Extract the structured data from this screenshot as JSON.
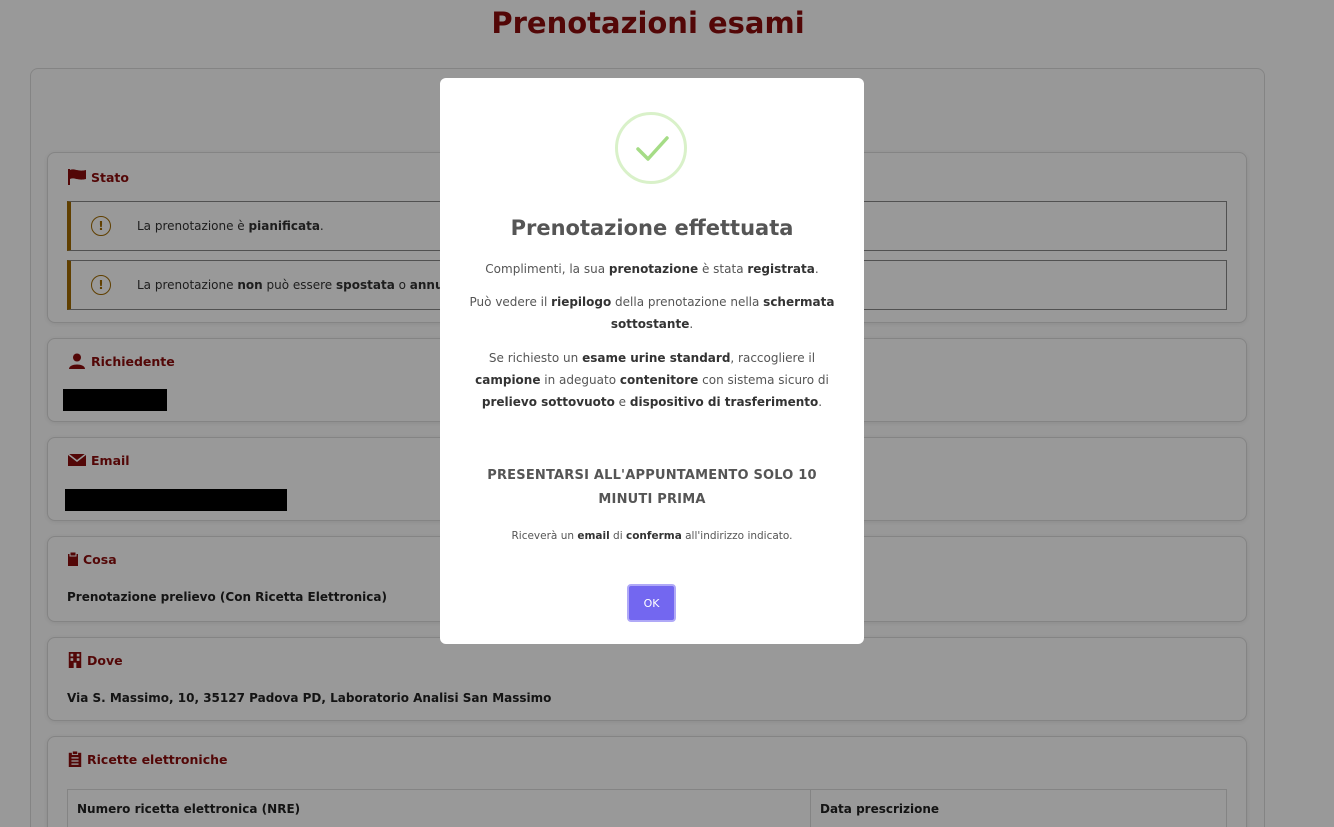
{
  "page": {
    "title": "Prenotazioni esami"
  },
  "stato": {
    "heading": "Stato",
    "alert1": {
      "prefix": "La prenotazione è ",
      "bold": "pianificata",
      "suffix": "."
    },
    "alert2": {
      "text1": "La prenotazione ",
      "bold1": "non",
      "text2": " può essere ",
      "bold2": "spostata",
      "text3": " o ",
      "bold3": "annu"
    }
  },
  "richiedente": {
    "heading": "Richiedente"
  },
  "email": {
    "heading": "Email"
  },
  "cosa": {
    "heading": "Cosa",
    "value": "Prenotazione prelievo (Con Ricetta Elettronica)"
  },
  "dove": {
    "heading": "Dove",
    "value": "Via S. Massimo, 10, 35127 Padova PD, Laboratorio Analisi San Massimo"
  },
  "ricette": {
    "heading": "Ricette elettroniche",
    "columns": [
      "Numero ricetta elettronica (NRE)",
      "Data prescrizione"
    ]
  },
  "modal": {
    "title": "Prenotazione effettuata",
    "p1": {
      "t1": "Complimenti, la sua ",
      "b1": "prenotazione",
      "t2": " è stata ",
      "b2": "registrata",
      "t3": "."
    },
    "p2": {
      "t1": "Può vedere il ",
      "b1": "riepilogo",
      "t2": " della prenotazione nella ",
      "b2": "schermata sottostante",
      "t3": "."
    },
    "p3": {
      "t1": "Se richiesto un ",
      "b1": "esame urine standard",
      "t2": ", raccogliere il ",
      "b2": "campione",
      "t3": " in adeguato ",
      "b3": "contenitore",
      "t4": " con sistema sicuro di ",
      "b4": "prelievo sottovuoto",
      "t5": " e ",
      "b5": "dispositivo di trasferimento",
      "t6": "."
    },
    "notice": "PRESENTARSI ALL'APPUNTAMENTO SOLO 10 MINUTI PRIMA",
    "small": {
      "t1": "Riceverà un ",
      "b1": "email",
      "t2": " di ",
      "b2": "conferma",
      "t3": " all'indirizzo indicato."
    },
    "ok_label": "OK"
  },
  "colors": {
    "brand": "#8b0d0d",
    "warning": "#a06a00",
    "success": "#a5dc86",
    "button": "#7367f0"
  }
}
